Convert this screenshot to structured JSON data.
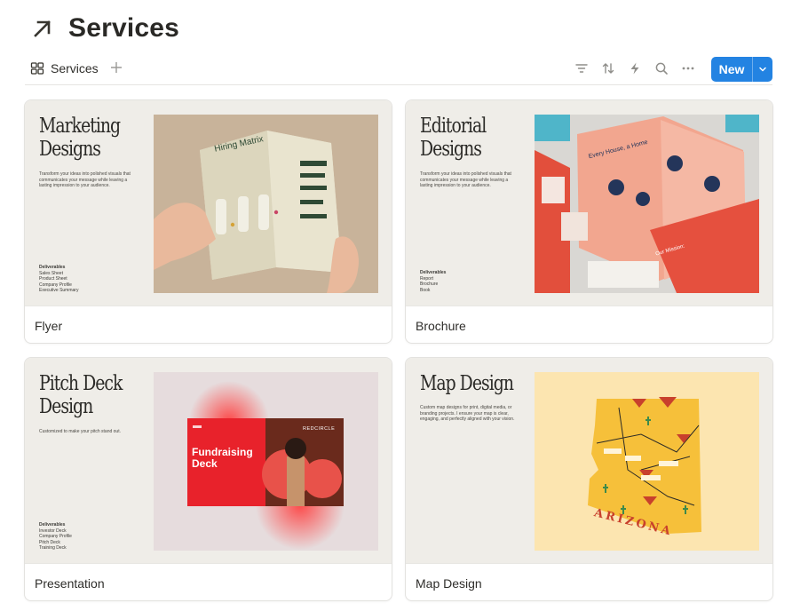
{
  "page": {
    "title": "Services",
    "icon": "arrow-up-right-icon"
  },
  "toolbar": {
    "view_tab_label": "Services",
    "view_tab_icon": "gallery-grid-icon",
    "tools": [
      "filter-icon",
      "sort-icon",
      "automation-bolt-icon",
      "search-icon",
      "more-icon"
    ],
    "new_label": "New"
  },
  "cards": [
    {
      "title": "Flyer",
      "cover": {
        "heading": "Marketing\nDesigns",
        "description": "Transform your ideas into polished visuals that communicates your message while leaving a lasting impression to your audience.",
        "deliverables_heading": "Deliverables",
        "deliverables": [
          "Sales Sheet",
          "Product Sheet",
          "Company Profile",
          "Executive Summary"
        ],
        "image_text": "Hiring Matrix"
      }
    },
    {
      "title": "Brochure",
      "cover": {
        "heading": "Editorial\nDesigns",
        "description": "Transform your ideas into polished visuals that communicates your message while leaving a lasting impression to your audience.",
        "deliverables_heading": "Deliverables",
        "deliverables": [
          "Report",
          "Brochure",
          "Book"
        ],
        "image_text": "Every House, a Home",
        "image_text_2": "Our Mission:"
      }
    },
    {
      "title": "Presentation",
      "cover": {
        "heading": "Pitch Deck\nDesign",
        "description": "Customized to make your pitch stand out.",
        "deliverables_heading": "Deliverables",
        "deliverables": [
          "Investor Deck",
          "Company Profile",
          "Pitch Deck",
          "Training Deck"
        ],
        "image_text": "Fundraising Deck",
        "image_text_2": "REDCIRCLE"
      }
    },
    {
      "title": "Map Design",
      "cover": {
        "heading": "Map Design",
        "description": "Custom map designs for print, digital media, or branding projects. I ensure your map is clear, engaging, and perfectly aligned with your vision.",
        "deliverables_heading": "",
        "deliverables": [],
        "image_text": "ARIZONA"
      }
    }
  ],
  "colors": {
    "accent": "#2383e2",
    "cover_bg": "#efede8",
    "red": "#e8372c",
    "map_yellow": "#f6c03a"
  }
}
